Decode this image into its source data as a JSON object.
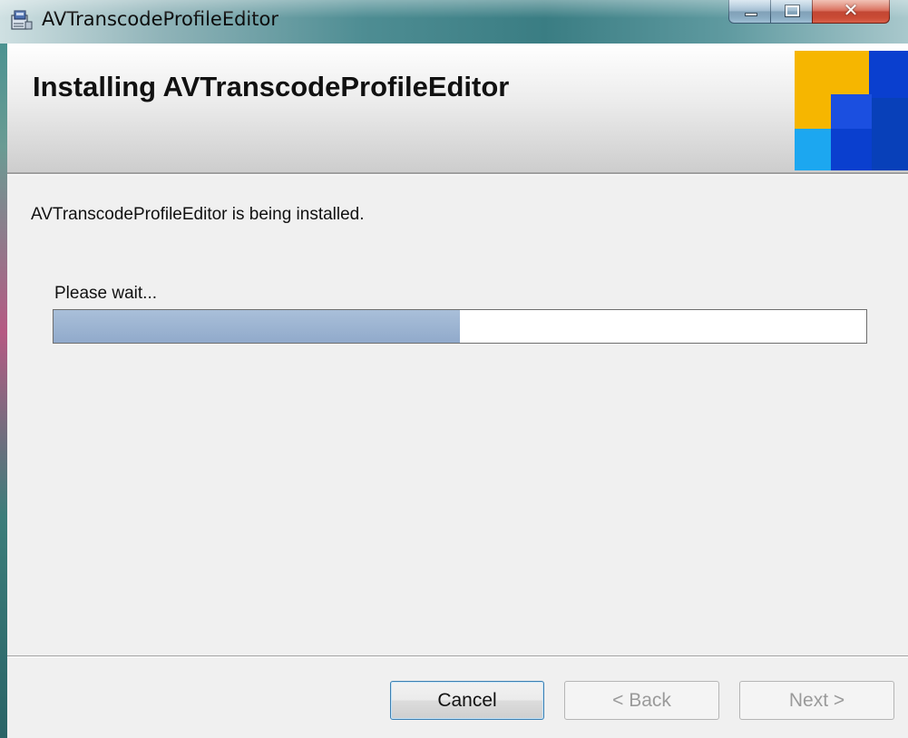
{
  "window": {
    "title": "AVTranscodeProfileEditor"
  },
  "banner": {
    "title": "Installing AVTranscodeProfileEditor"
  },
  "main": {
    "status": "AVTranscodeProfileEditor is being installed.",
    "wait_label": "Please wait...",
    "progress_percent": 50
  },
  "buttons": {
    "cancel": "Cancel",
    "back": "< Back",
    "next": "Next >"
  },
  "colors": {
    "progress_fill": "#9cb3d1",
    "logo_yellow": "#f6b600",
    "logo_blue": "#0a3fcf",
    "logo_light_blue": "#1ca7f0",
    "logo_dark_blue": "#0840b9"
  },
  "icons": {
    "app": "installer-package-icon",
    "minimize": "minimize-icon",
    "maximize": "maximize-icon",
    "close": "close-icon"
  }
}
